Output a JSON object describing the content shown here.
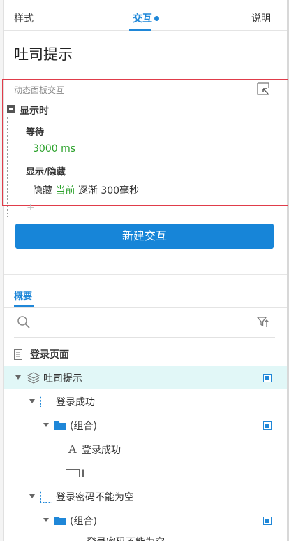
{
  "tabs": {
    "style": "样式",
    "interactions": "交互",
    "notes": "说明"
  },
  "widget_name": "吐司提示",
  "interaction_panel": {
    "header": "动态面板交互",
    "event": "显示时",
    "actions": [
      {
        "title": "等待",
        "detail": "3000 ms"
      },
      {
        "title": "显示/隐藏",
        "detail_prefix": "隐藏",
        "detail_target": "当前",
        "detail_suffix": "逐渐 300毫秒"
      }
    ],
    "add_symbol": "+"
  },
  "new_interaction_button": "新建交互",
  "outline": {
    "tab": "概要",
    "page": "登录页面",
    "items": [
      {
        "label": "吐司提示",
        "type": "dynamic-panel"
      },
      {
        "label": "登录成功",
        "type": "state"
      },
      {
        "label": "(组合)",
        "type": "group"
      },
      {
        "label": "登录成功",
        "type": "text"
      },
      {
        "label": "",
        "type": "rectangle"
      },
      {
        "label": "登录密码不能为空",
        "type": "state"
      },
      {
        "label": "(组合)",
        "type": "group"
      },
      {
        "label": "登录密码不能为空",
        "type": "text"
      }
    ]
  },
  "colors": {
    "accent": "#1f87d8",
    "green": "#2aa12a",
    "highlight_border": "#e03c4a",
    "selected_row": "#e1f7f7"
  }
}
